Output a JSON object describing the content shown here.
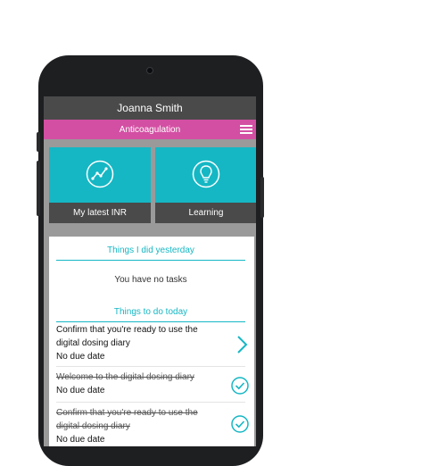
{
  "header": {
    "user_name": "Joanna Smith",
    "section": "Anticoagulation",
    "menu_icon": "hamburger-icon"
  },
  "tiles": [
    {
      "label": "My latest INR",
      "icon": "line-chart-icon"
    },
    {
      "label": "Learning",
      "icon": "lightbulb-icon"
    }
  ],
  "yesterday": {
    "heading": "Things I did yesterday",
    "empty": "You have no tasks"
  },
  "today": {
    "heading": "Things to do today",
    "tasks": [
      {
        "title": "Confirm that you're ready to use the digital dosing diary",
        "due": "No due date",
        "status": "open"
      },
      {
        "title": "Welcome to the digital dosing diary",
        "due": "No due date",
        "status": "done"
      },
      {
        "title": "Confirm that you're ready to use the digital dosing diary",
        "due": "No due date",
        "status": "done"
      }
    ]
  },
  "colors": {
    "accent": "#15b7c4",
    "brand_pink": "#d34fa3",
    "bar_dark": "#4a4a4a"
  }
}
